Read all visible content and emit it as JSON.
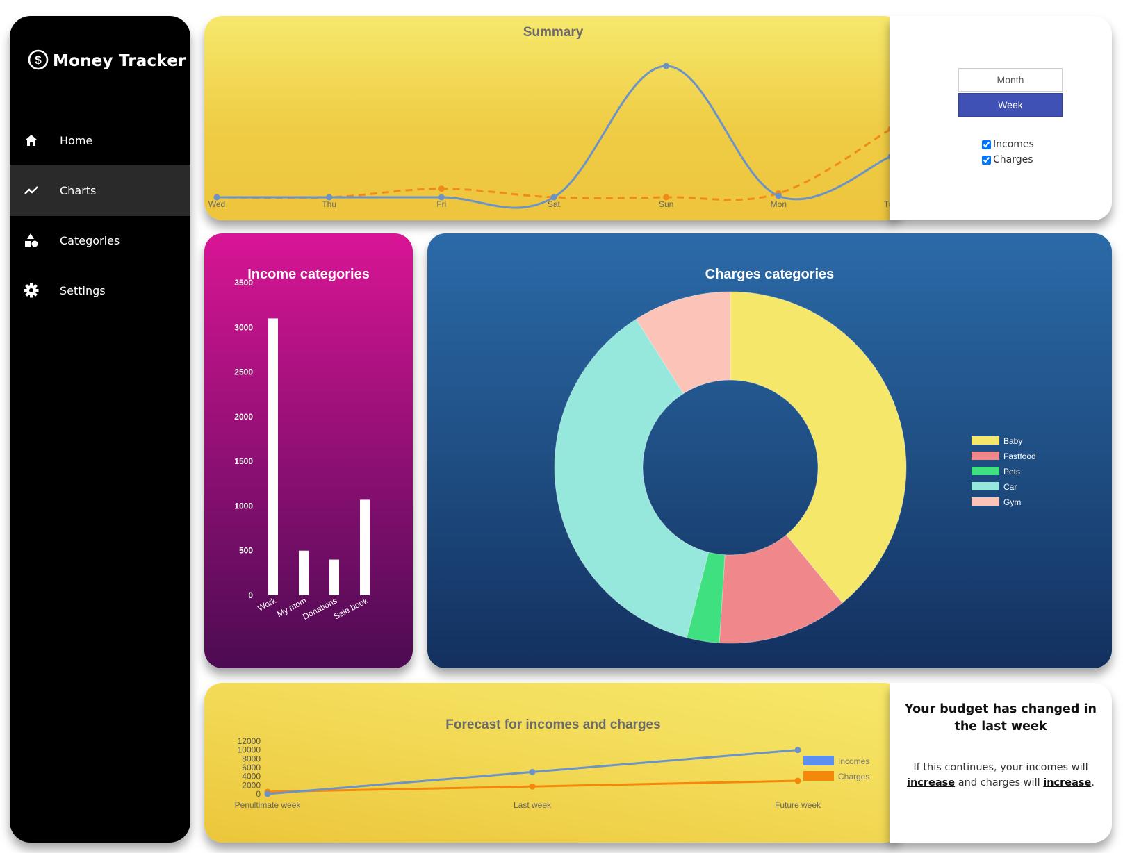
{
  "app": {
    "title": "Money Tracker",
    "logo_icon": "dollar-circle-icon"
  },
  "sidebar": {
    "items": [
      {
        "label": "Home",
        "icon": "home-icon",
        "active": false
      },
      {
        "label": "Charts",
        "icon": "chart-line-icon",
        "active": true
      },
      {
        "label": "Categories",
        "icon": "categories-shapes-icon",
        "active": false
      },
      {
        "label": "Settings",
        "icon": "gear-icon",
        "active": false
      }
    ]
  },
  "controls": {
    "range_options": [
      "Month",
      "Week"
    ],
    "selected_range": "Week",
    "filters": [
      {
        "label": "Incomes",
        "checked": true
      },
      {
        "label": "Charges",
        "checked": true
      }
    ],
    "colors": {
      "week_button": "#3f51b5"
    }
  },
  "budget": {
    "title": "Your budget has changed in the last week",
    "text_prefix": "If this continues, your incomes will",
    "incomes_trend": "increase",
    "text_middle": "and charges will",
    "charges_trend": "increase",
    "text_suffix": "."
  },
  "chart_data": [
    {
      "id": "summary",
      "type": "line",
      "title": "Summary",
      "categories": [
        "Wed",
        "Thu",
        "Fri",
        "Sat",
        "Sun",
        "Mon",
        "Tue"
      ],
      "series": [
        {
          "name": "Incomes",
          "values": [
            0,
            0,
            0,
            0,
            1000,
            10,
            310
          ],
          "color": "#6b93c8",
          "dashed": false
        },
        {
          "name": "Charges",
          "values": [
            0,
            0,
            65,
            0,
            0,
            30,
            520
          ],
          "color": "#f08a1c",
          "dashed": true
        }
      ],
      "ylim": [
        0,
        1000
      ],
      "grid": false,
      "legend": "none"
    },
    {
      "id": "income-categories",
      "type": "bar",
      "title": "Income categories",
      "categories": [
        "Work",
        "My mom",
        "Donations",
        "Sale book"
      ],
      "values": [
        3100,
        500,
        400,
        1070
      ],
      "yticks": [
        0,
        500,
        1000,
        1500,
        2000,
        2500,
        3000,
        3500
      ],
      "ylim": [
        0,
        3500
      ],
      "bar_color": "#ffffff"
    },
    {
      "id": "charges-categories",
      "type": "pie",
      "title": "Charges categories",
      "doughnut": true,
      "labels": [
        "Baby",
        "Fastfood",
        "Pets",
        "Car",
        "Gym"
      ],
      "values": [
        39,
        12,
        3,
        37,
        9
      ],
      "colors": [
        "#f5e76a",
        "#ef878b",
        "#3ee07f",
        "#96e8dc",
        "#fcc3b8"
      ],
      "legend": "right"
    },
    {
      "id": "forecast",
      "type": "line",
      "title": "Forecast for incomes and charges",
      "categories": [
        "Penultimate week",
        "Last week",
        "Future week"
      ],
      "series": [
        {
          "name": "Incomes",
          "values": [
            0,
            5000,
            10000
          ],
          "color": "#6b93c8"
        },
        {
          "name": "Charges",
          "values": [
            500,
            1700,
            3000
          ],
          "color": "#f5870a"
        }
      ],
      "yticks": [
        0,
        2000,
        4000,
        6000,
        8000,
        10000,
        12000
      ],
      "ylim": [
        0,
        12000
      ],
      "legend": "right"
    }
  ]
}
